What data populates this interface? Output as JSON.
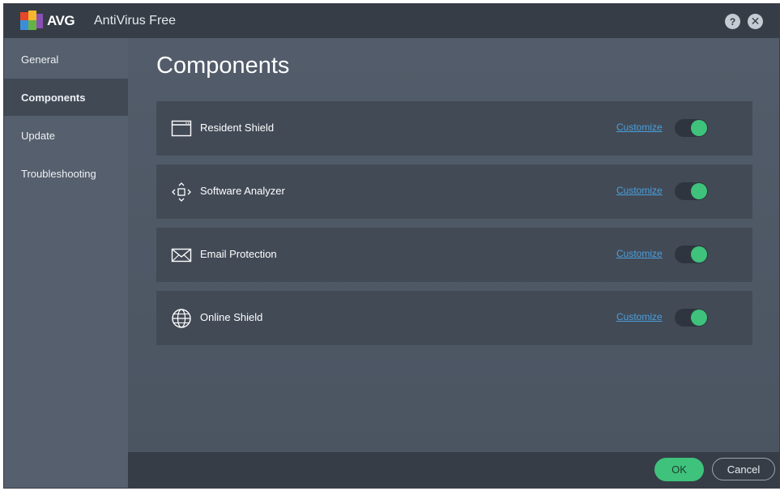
{
  "app": {
    "brand": "AVG",
    "title": "AntiVirus Free",
    "help_label": "?",
    "close_label": "✕"
  },
  "sidebar": {
    "items": [
      {
        "label": "General",
        "active": false
      },
      {
        "label": "Components",
        "active": true
      },
      {
        "label": "Update",
        "active": false
      },
      {
        "label": "Troubleshooting",
        "active": false
      }
    ]
  },
  "main": {
    "title": "Components",
    "components": [
      {
        "label": "Resident Shield",
        "icon": "window-icon",
        "link": "Customize",
        "enabled": true
      },
      {
        "label": "Software Analyzer",
        "icon": "move-arrows-icon",
        "link": "Customize",
        "enabled": true
      },
      {
        "label": "Email Protection",
        "icon": "envelope-icon",
        "link": "Customize",
        "enabled": true
      },
      {
        "label": "Online Shield",
        "icon": "globe-icon",
        "link": "Customize",
        "enabled": true
      }
    ]
  },
  "footer": {
    "ok_label": "OK",
    "cancel_label": "Cancel"
  },
  "colors": {
    "accent_green": "#3ec27c",
    "link_blue": "#4aa0dc",
    "titlebar": "#363d47",
    "sidebar": "#555f6d",
    "card": "#424a56"
  }
}
